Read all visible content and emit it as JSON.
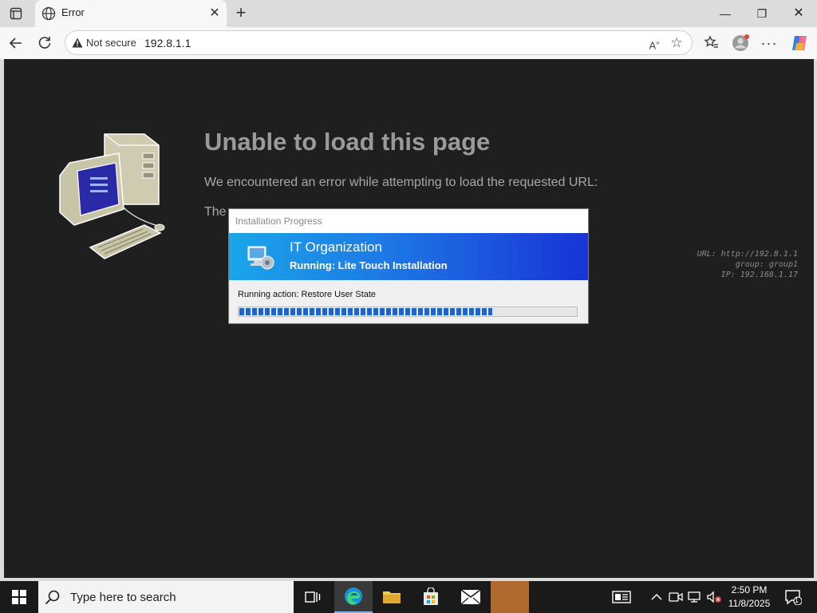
{
  "browser": {
    "tab": {
      "title": "Error"
    },
    "address": {
      "security_label": "Not secure",
      "url": "192.8.1.1"
    }
  },
  "page": {
    "heading": "Unable to load this page",
    "description": "We encountered an error while attempting to load the requested URL:",
    "description_partial": "The",
    "meta": {
      "url_line": "URL: http://192.8.1.1",
      "group_line": "group: group1",
      "ip_line": "IP: 192.168.1.17"
    }
  },
  "dialog": {
    "title": "Installation Progress",
    "org": "IT Organization",
    "running": "Running: Lite Touch Installation",
    "action": "Running action: Restore User State",
    "progress": 0.75,
    "colors": {
      "banner_start": "#1aa6e8",
      "banner_end": "#1a33d6",
      "progress": "#1b66c9"
    }
  },
  "taskbar": {
    "search_placeholder": "Type here to search",
    "time": "2:50 PM",
    "date": "11/8/2025",
    "notification_count": "1"
  }
}
